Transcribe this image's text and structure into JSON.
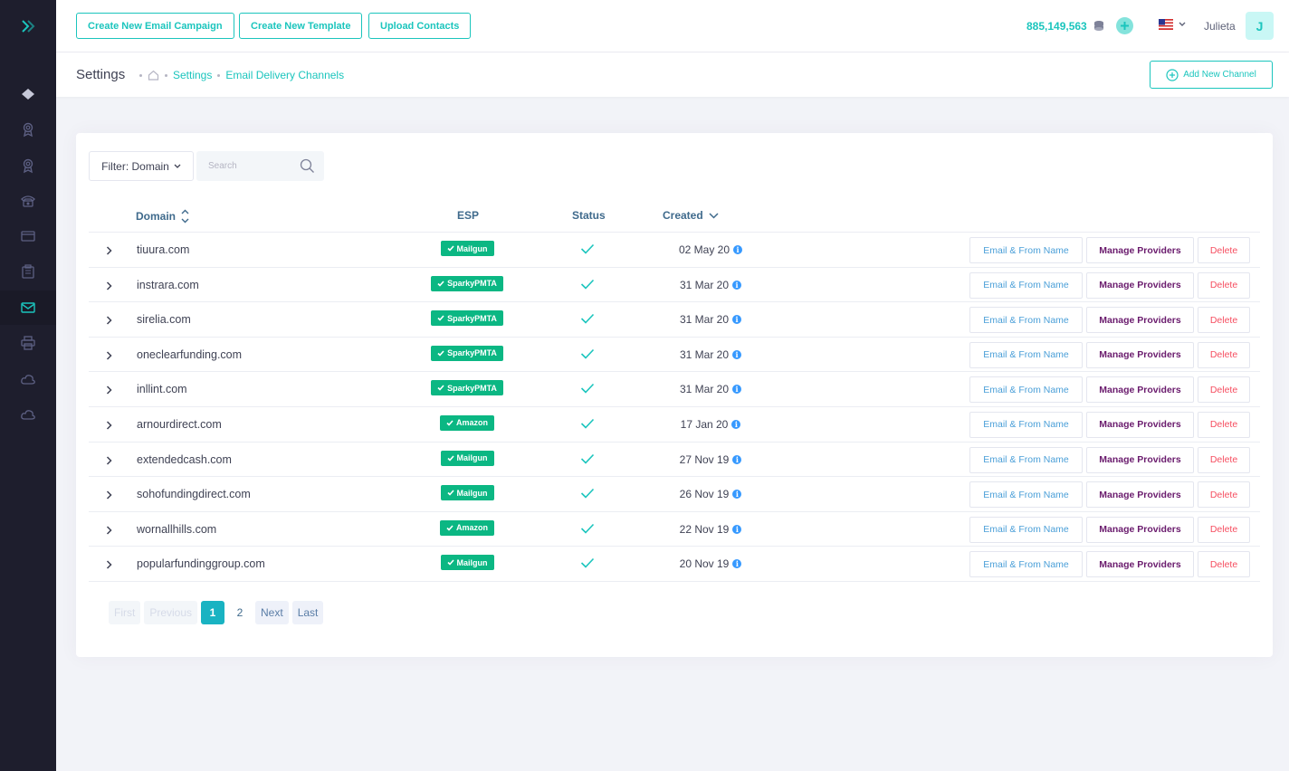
{
  "colors": {
    "sidebar_bg": "#1e1e2d",
    "accent": "#1bc5bd",
    "badge": "#0bb783",
    "manage": "#6a1b6d",
    "delete": "#f64e60",
    "info": "#3699ff"
  },
  "header": {
    "buttons": [
      "Create New Email Campaign",
      "Create New Template",
      "Upload Contacts"
    ],
    "credits": "885,149,563",
    "user_name": "Julieta",
    "avatar_letter": "J"
  },
  "sidebar": {
    "icons": [
      "layers-icon",
      "award-icon",
      "award-icon",
      "phone-icon",
      "card-icon",
      "clipboard-icon",
      "mail-icon",
      "printer-icon",
      "cloud-icon",
      "cloud-icon"
    ],
    "active_index": 6
  },
  "subheader": {
    "title": "Settings",
    "breadcrumbs": [
      "Settings",
      "Email Delivery Channels"
    ],
    "add_button": "Add New Channel"
  },
  "toolbar": {
    "filter_label": "Filter: Domain",
    "search_placeholder": "Search"
  },
  "table": {
    "columns": {
      "domain": "Domain",
      "esp": "ESP",
      "status": "Status",
      "created": "Created"
    },
    "action_labels": {
      "email": "Email & From Name",
      "manage": "Manage Providers",
      "delete": "Delete"
    },
    "rows": [
      {
        "domain": "tiuura.com",
        "esp": "Mailgun",
        "created": "02 May 20"
      },
      {
        "domain": "instrara.com",
        "esp": "SparkyPMTA",
        "created": "31 Mar 20"
      },
      {
        "domain": "sirelia.com",
        "esp": "SparkyPMTA",
        "created": "31 Mar 20"
      },
      {
        "domain": "oneclearfunding.com",
        "esp": "SparkyPMTA",
        "created": "31 Mar 20"
      },
      {
        "domain": "inllint.com",
        "esp": "SparkyPMTA",
        "created": "31 Mar 20"
      },
      {
        "domain": "arnourdirect.com",
        "esp": "Amazon",
        "created": "17 Jan 20"
      },
      {
        "domain": "extendedcash.com",
        "esp": "Mailgun",
        "created": "27 Nov 19"
      },
      {
        "domain": "sohofundingdirect.com",
        "esp": "Mailgun",
        "created": "26 Nov 19"
      },
      {
        "domain": "wornallhills.com",
        "esp": "Amazon",
        "created": "22 Nov 19"
      },
      {
        "domain": "popularfundinggroup.com",
        "esp": "Mailgun",
        "created": "20 Nov 19"
      }
    ]
  },
  "pagination": {
    "first": "First",
    "previous": "Previous",
    "pages": [
      "1",
      "2"
    ],
    "current": "1",
    "next": "Next",
    "last": "Last"
  }
}
